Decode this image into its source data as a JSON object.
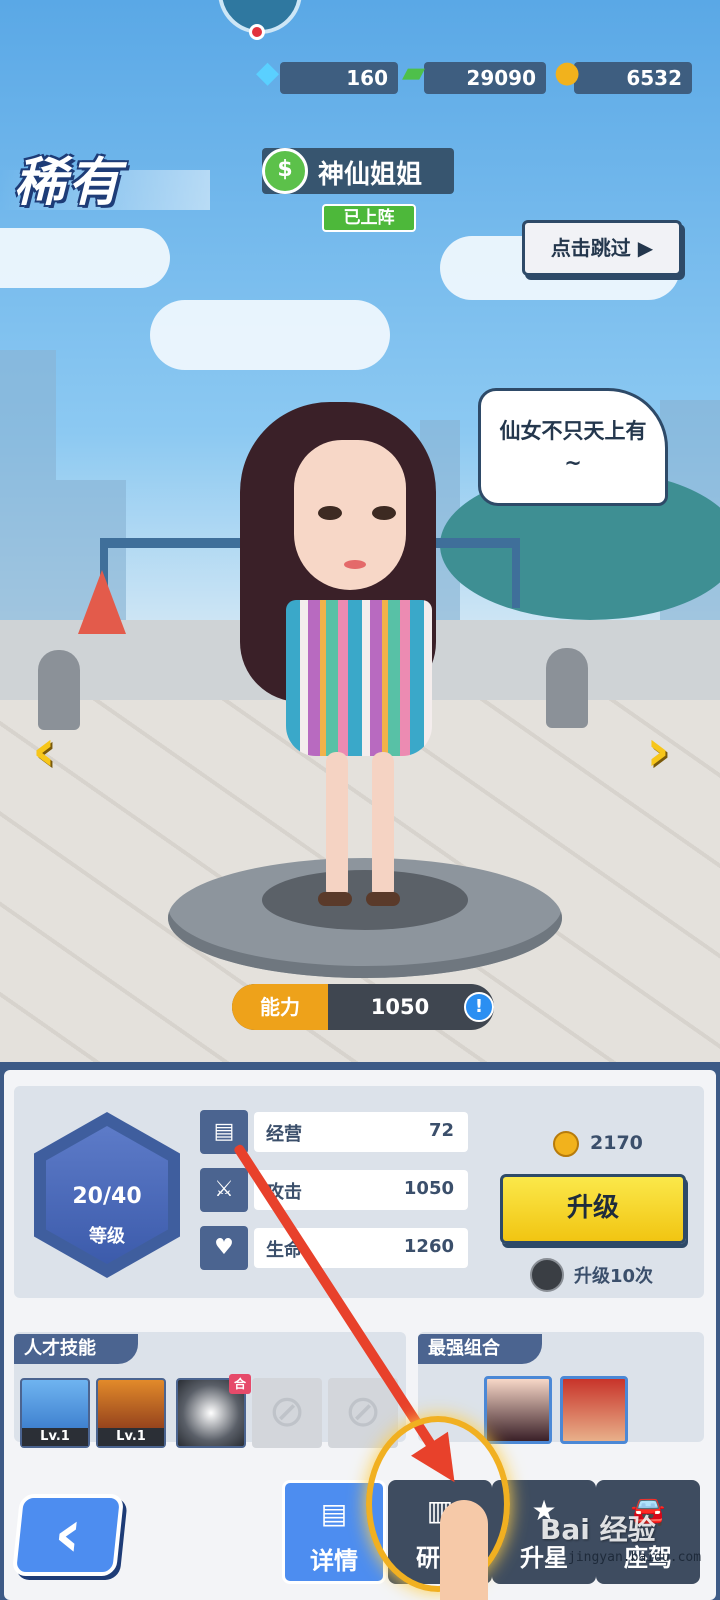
{
  "hud": {
    "diamonds": "160",
    "cash": "29090",
    "coins": "6532"
  },
  "rarity": "稀有",
  "character": {
    "name": "神仙姐姐",
    "status": "已上阵",
    "quote": "仙女不只天上有~",
    "power_label": "能力",
    "power_value": "1050"
  },
  "skip_button": "点击跳过",
  "level": {
    "value": "20/40",
    "label": "等级"
  },
  "stats": [
    {
      "name": "经营",
      "value": "72",
      "icon": "book-icon"
    },
    {
      "name": "攻击",
      "value": "1050",
      "icon": "sword-icon"
    },
    {
      "name": "生命",
      "value": "1260",
      "icon": "heart-icon"
    }
  ],
  "upgrade": {
    "cost": "2170",
    "button": "升级",
    "upgrade10_label": "升级10次"
  },
  "talent": {
    "title": "人才技能",
    "skills": [
      {
        "level": "Lv.1"
      },
      {
        "level": "Lv.1"
      },
      {
        "tag": "合"
      }
    ]
  },
  "combo": {
    "title": "最强组合"
  },
  "tabs": [
    {
      "label": "详情",
      "icon": "document-icon",
      "active": true
    },
    {
      "label": "研读",
      "icon": "book-reading-icon"
    },
    {
      "label": "升星",
      "icon": "star-up-icon"
    },
    {
      "label": "座驾",
      "icon": "car-icon"
    }
  ],
  "watermark": {
    "brand": "Bai 经验",
    "url": "jingyan.baidu.com"
  },
  "colors": {
    "panel": "#3d5a86",
    "upgrade": "#f4d21a",
    "power": "#eea21a",
    "accent_red": "#e8412b"
  }
}
